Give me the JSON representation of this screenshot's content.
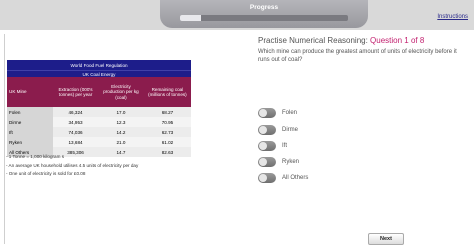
{
  "header": {
    "progress_label": "Progress",
    "progress_fraction": 0.125,
    "instructions_link": "Instructions"
  },
  "table": {
    "title": "World Food Fuel Regulation",
    "subtitle": "UK Coal Energy",
    "columns": [
      "UK Mine",
      "Extraction (000's tonnes) per year",
      "Electricity production per kg (coal)",
      "Remaining coal (millions of tonnes)"
    ],
    "rows": [
      [
        "Folen",
        "46,324",
        "17.0",
        "68.27"
      ],
      [
        "Dirme",
        "34,953",
        "12.3",
        "70.95"
      ],
      [
        "Ift",
        "74,036",
        "14.2",
        "62.73"
      ],
      [
        "Ryken",
        "13,684",
        "21.0",
        "61.02"
      ],
      [
        "All Others",
        "385,306",
        "14.7",
        "82.63"
      ]
    ]
  },
  "notes": [
    "- 1 Tonne = 1,000 kilogram s",
    "- An average UK household utilises 4.5 units of electricity per day",
    "- One unit of electricity is sold for £0.08"
  ],
  "question": {
    "prefix": "Practise Numerical Reasoning: ",
    "number": "Question 1 of 8",
    "text": "Which mine can produce the greatest amount of units of electricity before it runs out of coal?"
  },
  "options": [
    "Folen",
    "Dirme",
    "Ift",
    "Ryken",
    "All Others"
  ],
  "next_button": "Next"
}
